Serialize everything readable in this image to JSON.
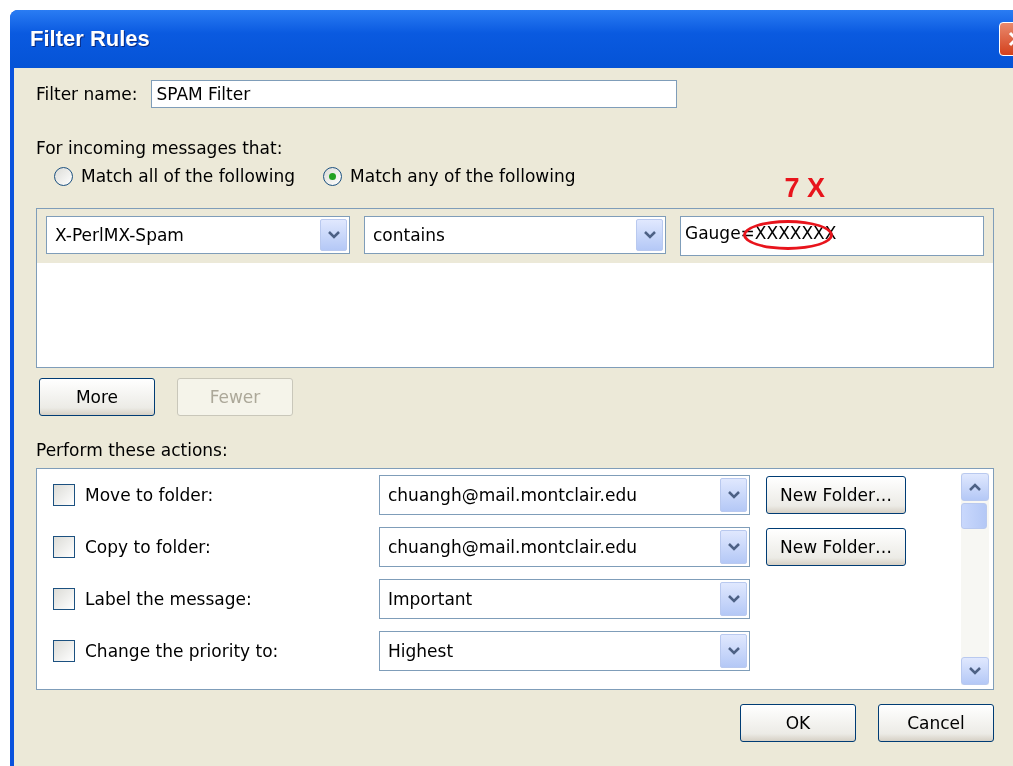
{
  "window": {
    "title": "Filter Rules"
  },
  "filter_name": {
    "label": "Filter name:",
    "value": "SPAM Filter"
  },
  "conditions": {
    "heading": "For incoming messages that:",
    "match_options": [
      {
        "label": "Match all of the following",
        "selected": false
      },
      {
        "label": "Match any of the following",
        "selected": true
      }
    ],
    "rules": [
      {
        "field": "X-PerlMX-Spam",
        "operator": "contains",
        "value": "Gauge=XXXXXXX"
      }
    ],
    "annotation": "7 X"
  },
  "rule_buttons": [
    {
      "label": "More",
      "disabled": false
    },
    {
      "label": "Fewer",
      "disabled": true
    }
  ],
  "actions": {
    "heading": "Perform these actions:",
    "items": [
      {
        "label": "Move to folder:",
        "checked": false,
        "value": "chuangh@mail.montclair.edu",
        "button": "New Folder…"
      },
      {
        "label": "Copy to folder:",
        "checked": false,
        "value": "chuangh@mail.montclair.edu",
        "button": "New Folder…"
      },
      {
        "label": "Label the message:",
        "checked": false,
        "value": "Important"
      },
      {
        "label": "Change the priority to:",
        "checked": false,
        "value": "Highest"
      }
    ]
  },
  "buttons": [
    "OK",
    "Cancel"
  ]
}
